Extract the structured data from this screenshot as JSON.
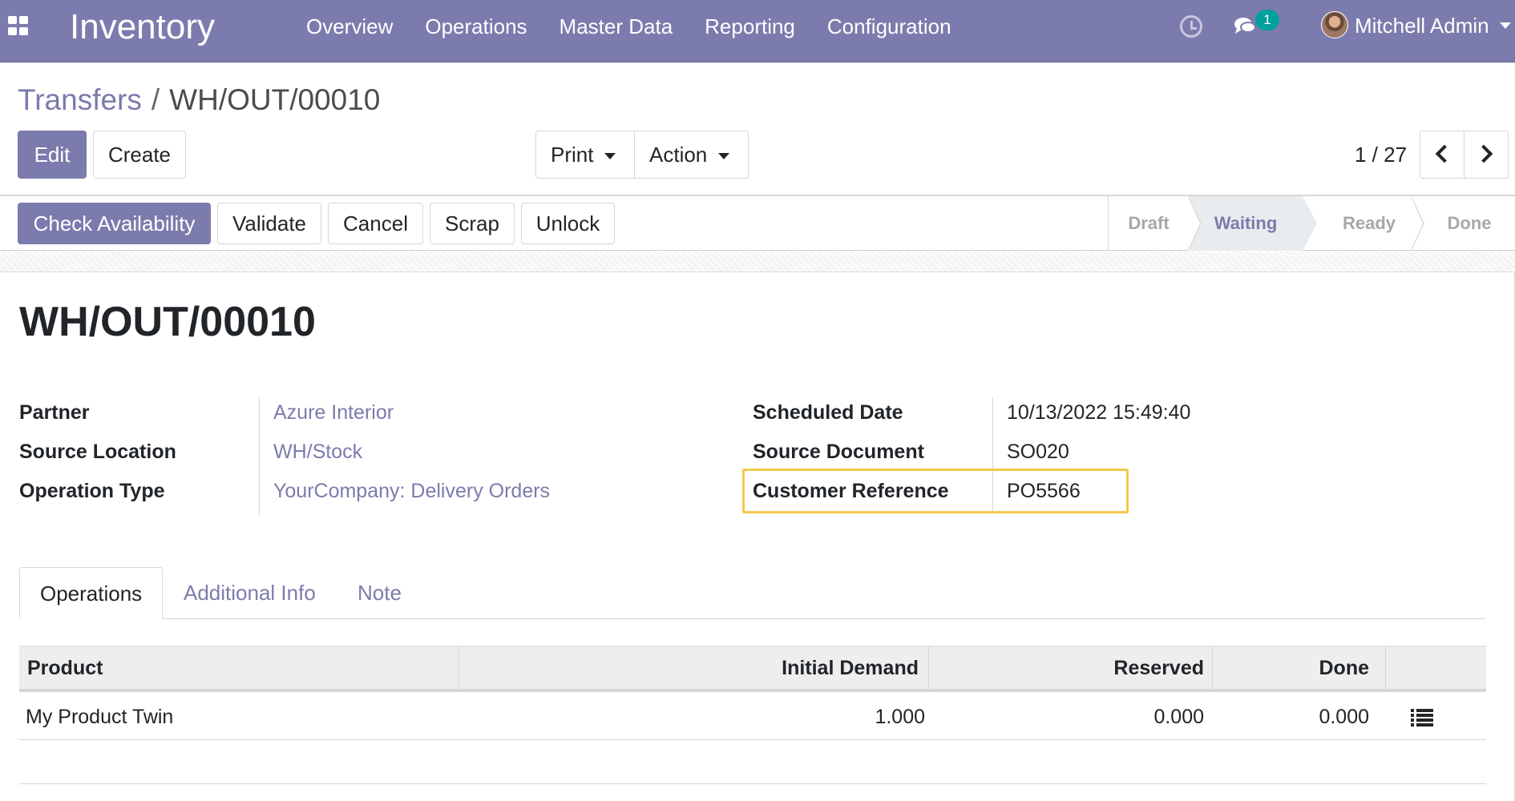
{
  "navbar": {
    "app_title": "Inventory",
    "menu": [
      "Overview",
      "Operations",
      "Master Data",
      "Reporting",
      "Configuration"
    ],
    "messages_count": "1",
    "user_name": "Mitchell Admin",
    "icons": [
      "apps-icon",
      "clock-icon",
      "chat-icon",
      "avatar"
    ],
    "bg_color": "#7c7bad"
  },
  "breadcrumb": {
    "parent": "Transfers",
    "separator": "/",
    "current": "WH/OUT/00010"
  },
  "toolbar": {
    "edit": "Edit",
    "create": "Create",
    "print": "Print",
    "action": "Action",
    "pager": "1 / 27"
  },
  "statusbar": {
    "buttons": [
      "Check Availability",
      "Validate",
      "Cancel",
      "Scrap",
      "Unlock"
    ],
    "stages": [
      "Draft",
      "Waiting",
      "Ready",
      "Done"
    ],
    "active_stage": "Waiting"
  },
  "record": {
    "name": "WH/OUT/00010",
    "left_fields": [
      {
        "label": "Partner",
        "value": "Azure Interior"
      },
      {
        "label": "Source Location",
        "value": "WH/Stock"
      },
      {
        "label": "Operation Type",
        "value": "YourCompany: Delivery Orders"
      }
    ],
    "right_fields": [
      {
        "label": "Scheduled Date",
        "value": "10/13/2022 15:49:40"
      },
      {
        "label": "Source Document",
        "value": "SO020"
      },
      {
        "label": "Customer Reference",
        "value": "PO5566"
      }
    ],
    "highlight_color": "#f2c94c"
  },
  "tabs": [
    "Operations",
    "Additional Info",
    "Note"
  ],
  "table": {
    "headers": [
      "Product",
      "Initial Demand",
      "Reserved",
      "Done"
    ],
    "rows": [
      {
        "product": "My Product Twin",
        "initial_demand": "1.000",
        "reserved": "0.000",
        "done": "0.000"
      }
    ]
  }
}
